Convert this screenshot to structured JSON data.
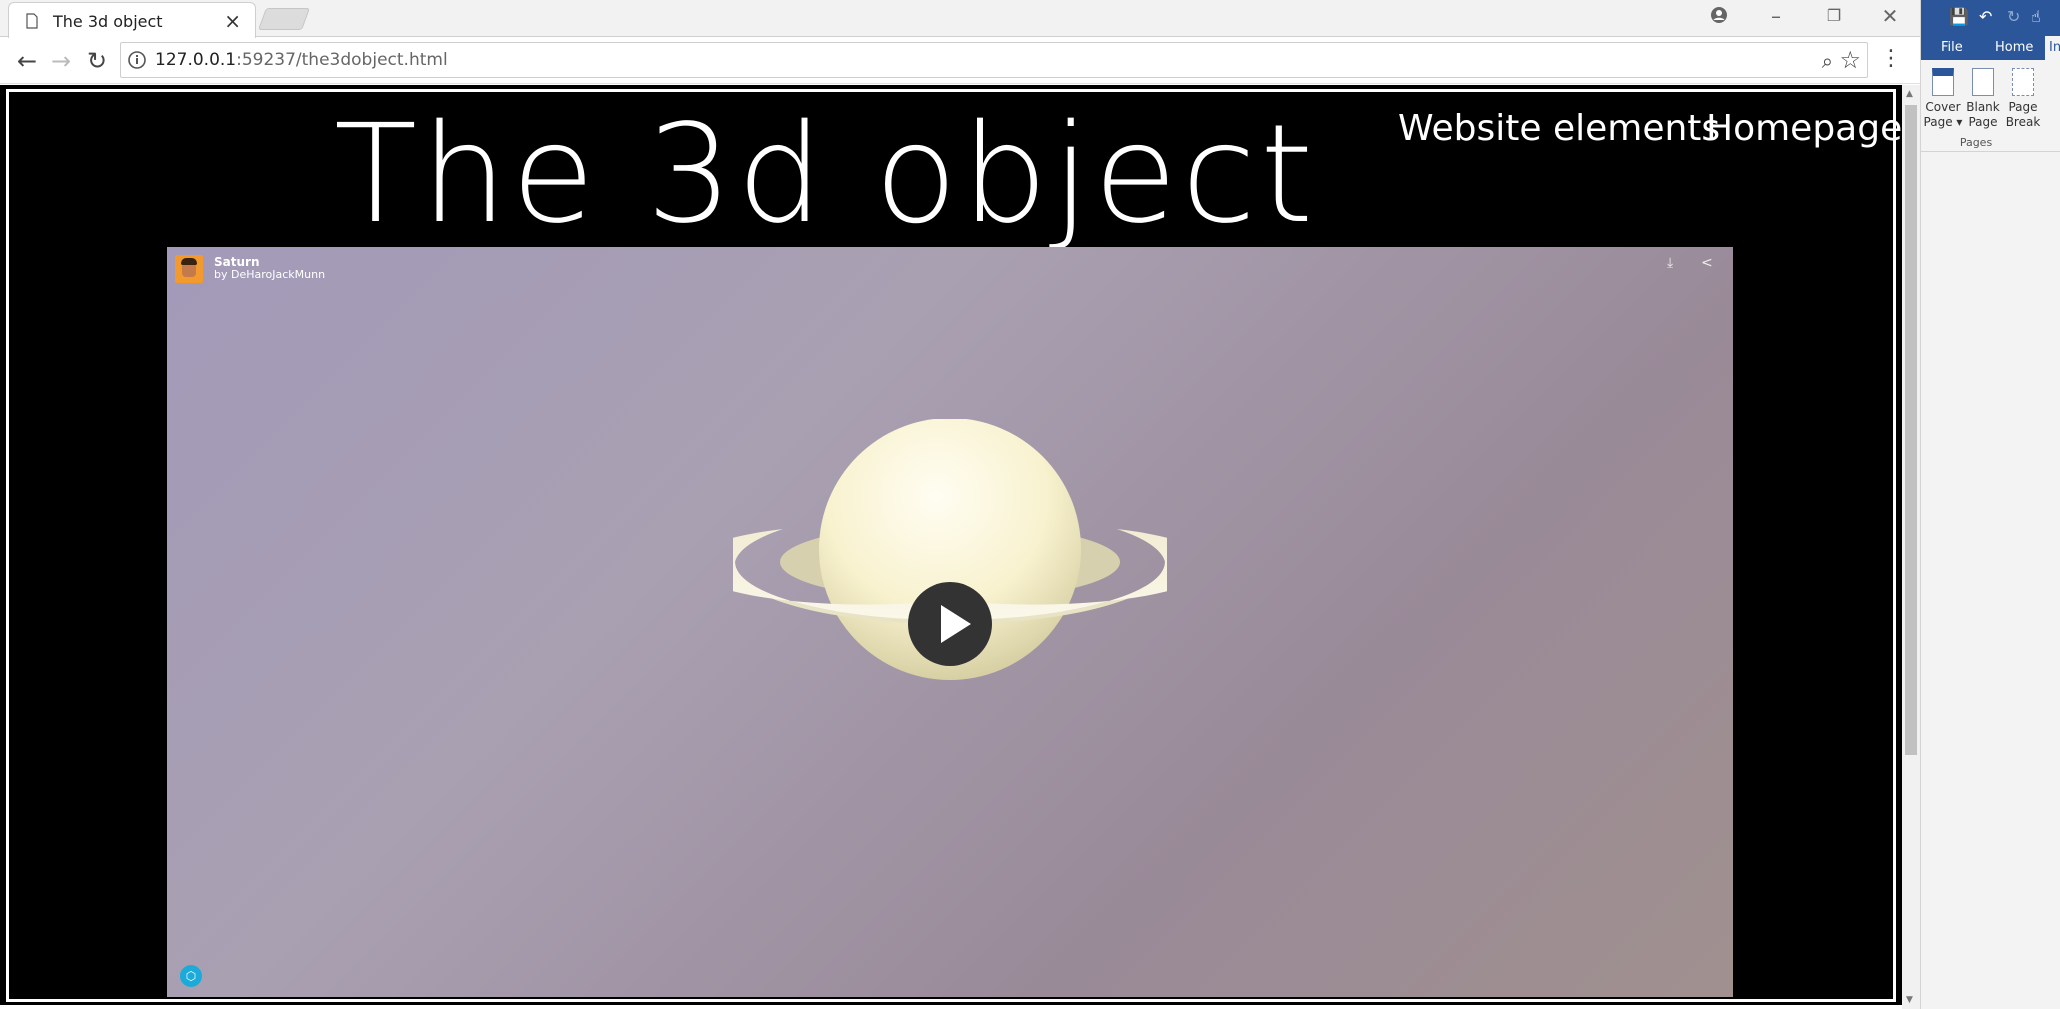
{
  "browser": {
    "tab_title": "The 3d object",
    "url_host": "127.0.0.1",
    "url_path": ":59237/the3dobject.html"
  },
  "site": {
    "title": "The 3d object",
    "nav": [
      "Website elements",
      "Homepage"
    ]
  },
  "viewer": {
    "model_name": "Saturn",
    "author_prefix": "by",
    "author": "DeHaroJackMunn"
  },
  "word": {
    "tabs": [
      "File",
      "Home",
      "Ins"
    ],
    "buttons": [
      {
        "line1": "Cover",
        "line2": "Page ▾"
      },
      {
        "line1": "Blank",
        "line2": "Page"
      },
      {
        "line1": "Page",
        "line2": "Break"
      }
    ],
    "group_label": "Pages"
  },
  "colors": {
    "word_blue": "#2b579a",
    "viewer_bg": "#a29ab8",
    "planet": "#f6f1cf"
  }
}
